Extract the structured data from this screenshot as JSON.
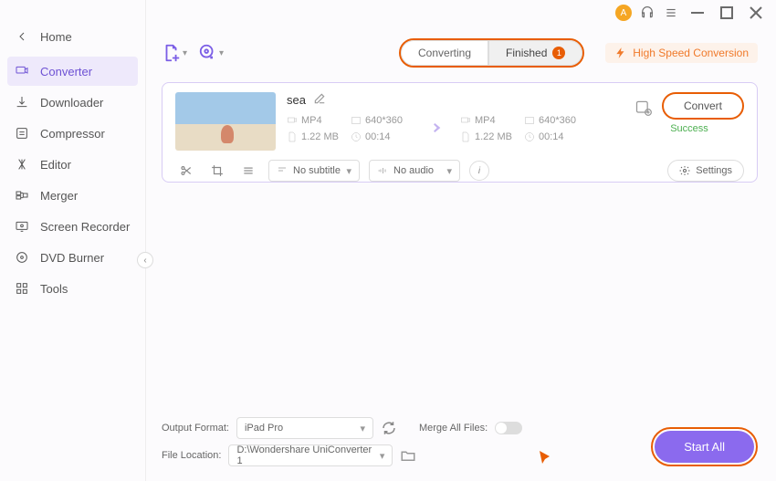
{
  "titlebar": {
    "avatar_initial": "A"
  },
  "sidebar": {
    "home": "Home",
    "items": [
      {
        "label": "Converter",
        "active": true
      },
      {
        "label": "Downloader"
      },
      {
        "label": "Compressor"
      },
      {
        "label": "Editor"
      },
      {
        "label": "Merger"
      },
      {
        "label": "Screen Recorder"
      },
      {
        "label": "DVD Burner"
      },
      {
        "label": "Tools"
      }
    ]
  },
  "toolbar": {
    "seg_converting": "Converting",
    "seg_finished": "Finished",
    "finished_badge": "1",
    "high_speed": "High Speed Conversion"
  },
  "file": {
    "name": "sea",
    "src_format": "MP4",
    "src_res": "640*360",
    "src_size": "1.22 MB",
    "src_dur": "00:14",
    "dst_format": "MP4",
    "dst_res": "640*360",
    "dst_size": "1.22 MB",
    "dst_dur": "00:14",
    "convert_label": "Convert",
    "status": "Success",
    "subtitle_label": "No subtitle",
    "audio_label": "No audio",
    "settings_label": "Settings"
  },
  "bottom": {
    "output_format_label": "Output Format:",
    "output_format_value": "iPad Pro",
    "merge_label": "Merge All Files:",
    "file_location_label": "File Location:",
    "file_location_value": "D:\\Wondershare UniConverter 1",
    "start_all": "Start All"
  }
}
